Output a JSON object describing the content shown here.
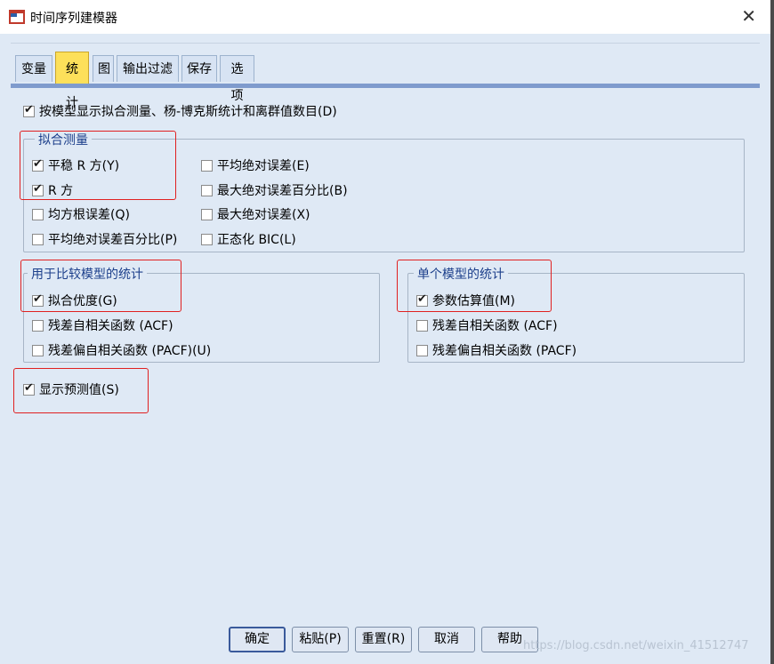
{
  "window": {
    "title": "时间序列建模器",
    "close": "✕"
  },
  "tabs": [
    "变量",
    "统计",
    "图",
    "输出过滤",
    "保存",
    "选项"
  ],
  "top_option": {
    "label": "按模型显示拟合测量、杨-博克斯统计和离群值数目(D)",
    "checked": true
  },
  "fit_measures": {
    "legend": "拟合测量",
    "items": [
      {
        "label": "平稳 R 方(Y)",
        "checked": true
      },
      {
        "label": "R 方",
        "checked": true
      },
      {
        "label": "均方根误差(Q)",
        "checked": false
      },
      {
        "label": "平均绝对误差百分比(P)",
        "checked": false
      },
      {
        "label": "平均绝对误差(E)",
        "checked": false
      },
      {
        "label": "最大绝对误差百分比(B)",
        "checked": false
      },
      {
        "label": "最大绝对误差(X)",
        "checked": false
      },
      {
        "label": "正态化 BIC(L)",
        "checked": false
      }
    ]
  },
  "compare_stats": {
    "legend": "用于比较模型的统计",
    "items": [
      {
        "label": "拟合优度(G)",
        "checked": true
      },
      {
        "label": "残差自相关函数 (ACF)",
        "checked": false
      },
      {
        "label": "残差偏自相关函数 (PACF)(U)",
        "checked": false
      }
    ]
  },
  "single_stats": {
    "legend": "单个模型的统计",
    "items": [
      {
        "label": "参数估算值(M)",
        "checked": true
      },
      {
        "label": "残差自相关函数 (ACF)",
        "checked": false
      },
      {
        "label": "残差偏自相关函数 (PACF)",
        "checked": false
      }
    ]
  },
  "forecast": {
    "label": "显示预测值(S)",
    "checked": true
  },
  "buttons": {
    "ok": "确定",
    "paste": "粘贴(P)",
    "reset": "重置(R)",
    "cancel": "取消",
    "help": "帮助"
  },
  "watermark": "https://blog.csdn.net/weixin_41512747",
  "colors": {
    "background": "#dfe9f5",
    "active_tab": "#fde05a",
    "highlight": "#e02020",
    "legend_text": "#1c3f8b"
  }
}
